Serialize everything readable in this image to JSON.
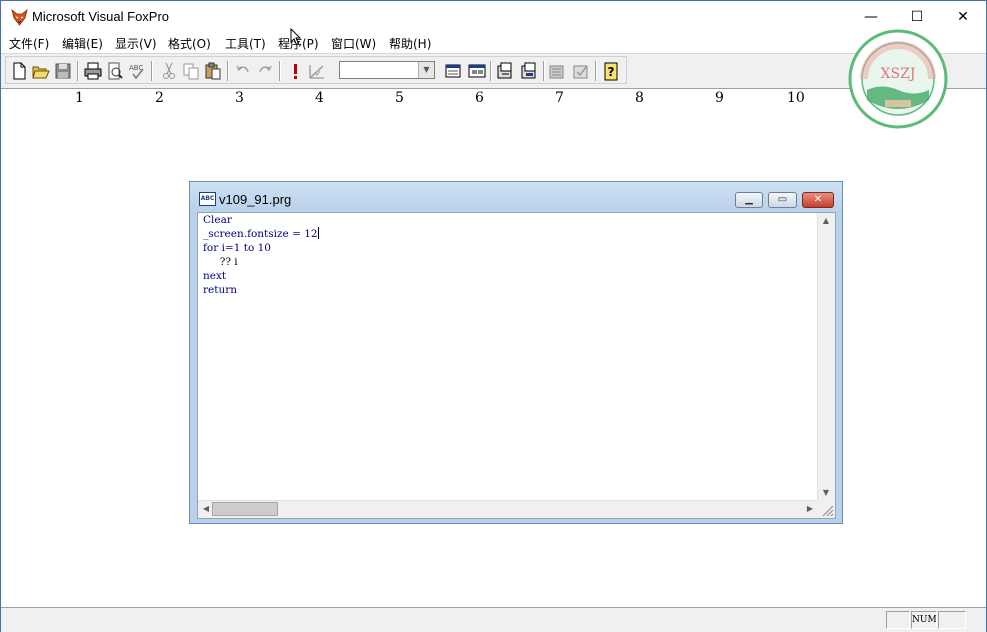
{
  "app": {
    "title": "Microsoft Visual FoxPro",
    "icon": "fox-icon"
  },
  "window_controls": {
    "minimize": "—",
    "maximize": "☐",
    "close": "✕"
  },
  "menu": [
    {
      "label": "文件(F)"
    },
    {
      "label": "编辑(E)"
    },
    {
      "label": "显示(V)"
    },
    {
      "label": "格式(O)"
    },
    {
      "label": "工具(T)"
    },
    {
      "label": "程序(P)"
    },
    {
      "label": "窗口(W)"
    },
    {
      "label": "帮助(H)"
    }
  ],
  "toolbar": {
    "icons": [
      "new-file-icon",
      "open-folder-icon",
      "save-icon",
      "print-icon",
      "print-preview-icon",
      "spell-check-icon",
      "cut-icon",
      "copy-icon",
      "paste-icon",
      "undo-icon",
      "redo-icon",
      "run-icon",
      "modify-form-icon",
      "database-icon",
      "command-window-icon",
      "form-designer-icon",
      "report-designer-icon",
      "data-session-icon",
      "builder-icon",
      "help-icon"
    ],
    "combo_value": ""
  },
  "output_numbers": [
    "1",
    "2",
    "3",
    "4",
    "5",
    "6",
    "7",
    "8",
    "9",
    "10"
  ],
  "logo": {
    "text": "XSZJ",
    "ring_text": "湛江市徐闻县职业技术教育中心",
    "color": "#2a9d5a"
  },
  "editor": {
    "title": "v109_91.prg",
    "icon_text": "ABC",
    "lines": [
      "Clear",
      "_screen.fontsize = 12",
      "for i=1 to 10",
      "     ?? i",
      "next",
      "return"
    ]
  },
  "status": {
    "panel1": "",
    "num": "NUM",
    "panel3": ""
  }
}
